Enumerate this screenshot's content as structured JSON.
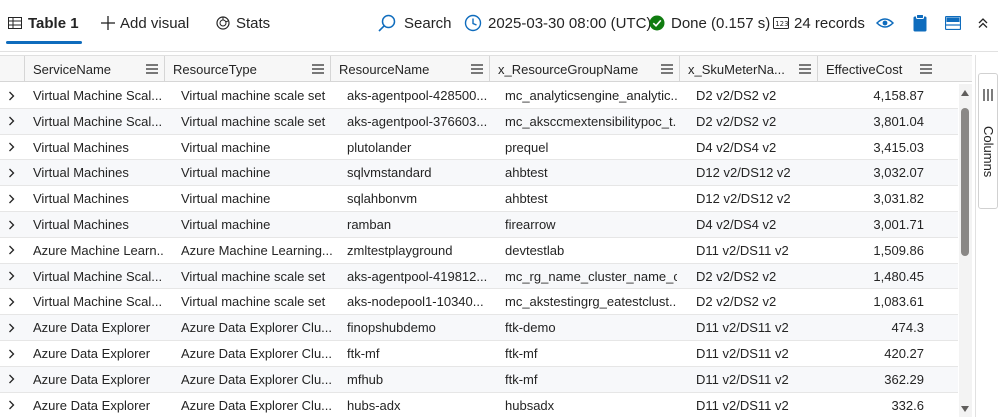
{
  "toolbar": {
    "tab_label": "Table 1",
    "add_visual_label": "Add visual",
    "stats_label": "Stats",
    "search_label": "Search",
    "time_label": "2025-03-30 08:00 (UTC)",
    "status_label": "Done (0.157 s)",
    "records_label": "24 records",
    "icons": [
      "table-icon",
      "plus-icon",
      "stats-icon",
      "search-icon",
      "clock-icon",
      "check-circle-icon",
      "records-icon",
      "eye-icon",
      "clipboard-icon",
      "layout-icon",
      "collapse-icon"
    ],
    "accent_color": "#0f6cbd",
    "done_color": "#107c10"
  },
  "grid": {
    "columns": [
      {
        "label": "ServiceName"
      },
      {
        "label": "ResourceType"
      },
      {
        "label": "ResourceName"
      },
      {
        "label": "x_ResourceGroupName"
      },
      {
        "label": "x_SkuMeterNa..."
      },
      {
        "label": "EffectiveCost"
      }
    ],
    "rows": [
      [
        "Virtual Machine Scal...",
        "Virtual machine scale set",
        "aks-agentpool-428500...",
        "mc_analyticsengine_analytic...",
        "D2 v2/DS2 v2",
        "4,158.87"
      ],
      [
        "Virtual Machine Scal...",
        "Virtual machine scale set",
        "aks-agentpool-376603...",
        "mc_aksccmextensibilitypoc_t...",
        "D2 v2/DS2 v2",
        "3,801.04"
      ],
      [
        "Virtual Machines",
        "Virtual machine",
        "plutolander",
        "prequel",
        "D4 v2/DS4 v2",
        "3,415.03"
      ],
      [
        "Virtual Machines",
        "Virtual machine",
        "sqlvmstandard",
        "ahbtest",
        "D12 v2/DS12 v2",
        "3,032.07"
      ],
      [
        "Virtual Machines",
        "Virtual machine",
        "sqlahbonvm",
        "ahbtest",
        "D12 v2/DS12 v2",
        "3,031.82"
      ],
      [
        "Virtual Machines",
        "Virtual machine",
        "ramban",
        "firearrow",
        "D4 v2/DS4 v2",
        "3,001.71"
      ],
      [
        "Azure Machine Learn...",
        "Azure Machine Learning...",
        "zmltestplayground",
        "devtestlab",
        "D11 v2/DS11 v2",
        "1,509.86"
      ],
      [
        "Virtual Machine Scal...",
        "Virtual machine scale set",
        "aks-agentpool-419812...",
        "mc_rg_name_cluster_name_c...",
        "D2 v2/DS2 v2",
        "1,480.45"
      ],
      [
        "Virtual Machine Scal...",
        "Virtual machine scale set",
        "aks-nodepool1-10340...",
        "mc_akstestingrg_eatestclust...",
        "D2 v2/DS2 v2",
        "1,083.61"
      ],
      [
        "Azure Data Explorer",
        "Azure Data Explorer Clu...",
        "finopshubdemo",
        "ftk-demo",
        "D11 v2/DS11 v2",
        "474.3"
      ],
      [
        "Azure Data Explorer",
        "Azure Data Explorer Clu...",
        "ftk-mf",
        "ftk-mf",
        "D11 v2/DS11 v2",
        "420.27"
      ],
      [
        "Azure Data Explorer",
        "Azure Data Explorer Clu...",
        "mfhub",
        "ftk-mf",
        "D11 v2/DS11 v2",
        "362.29"
      ],
      [
        "Azure Data Explorer",
        "Azure Data Explorer Clu...",
        "hubs-adx",
        "hubsadx",
        "D11 v2/DS11 v2",
        "332.6"
      ]
    ]
  },
  "side_panel": {
    "columns_label": "Columns"
  }
}
